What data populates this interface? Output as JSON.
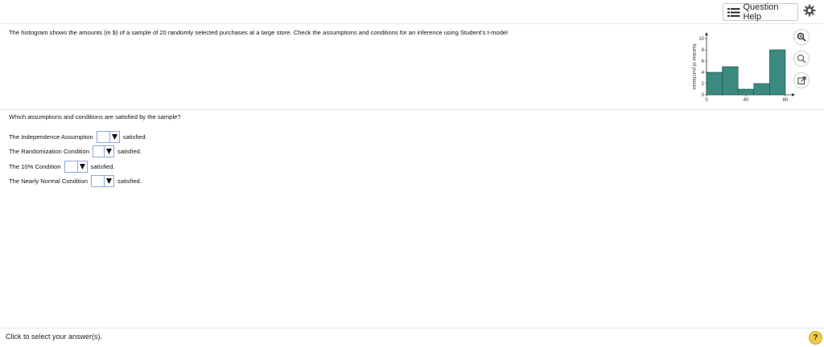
{
  "header": {
    "question_help_label": "Question Help",
    "icons": [
      "list-icon",
      "gear-icon"
    ]
  },
  "question": {
    "text": "The histogram shows the amounts (in $) of a sample of 20 randomly selected purchases at a large store. Check the assumptions and conditions for an inference using Student's t-model"
  },
  "chart_data": {
    "type": "bar",
    "title": "",
    "xlabel": "",
    "ylabel": "Number of purchases",
    "x_ticks": [
      "0",
      "40",
      "80"
    ],
    "y_ticks": [
      "0",
      "2",
      "4",
      "6",
      "8",
      "10"
    ],
    "bin_edges": [
      0,
      16,
      32,
      48,
      64,
      80
    ],
    "values": [
      4,
      5,
      1,
      2,
      8
    ],
    "ylim": [
      0,
      10
    ],
    "bar_color": "#3a8a80"
  },
  "side_icons": [
    "zoom-in-icon",
    "zoom-out-icon",
    "popout-icon"
  ],
  "prompt": "Which assumptions and conditions are satisfied by the sample?",
  "conditions": [
    {
      "label": "The Independence Assumption",
      "suffix": "satisfied."
    },
    {
      "label": "The Randomization Condition",
      "suffix": "satisfied."
    },
    {
      "label": "The 10% Condition",
      "suffix": "satisfied."
    },
    {
      "label": "The Nearly Normal Condition",
      "suffix": "satisfied."
    }
  ],
  "footer": {
    "instruction": "Click to select your answer(s).",
    "help_symbol": "?"
  }
}
